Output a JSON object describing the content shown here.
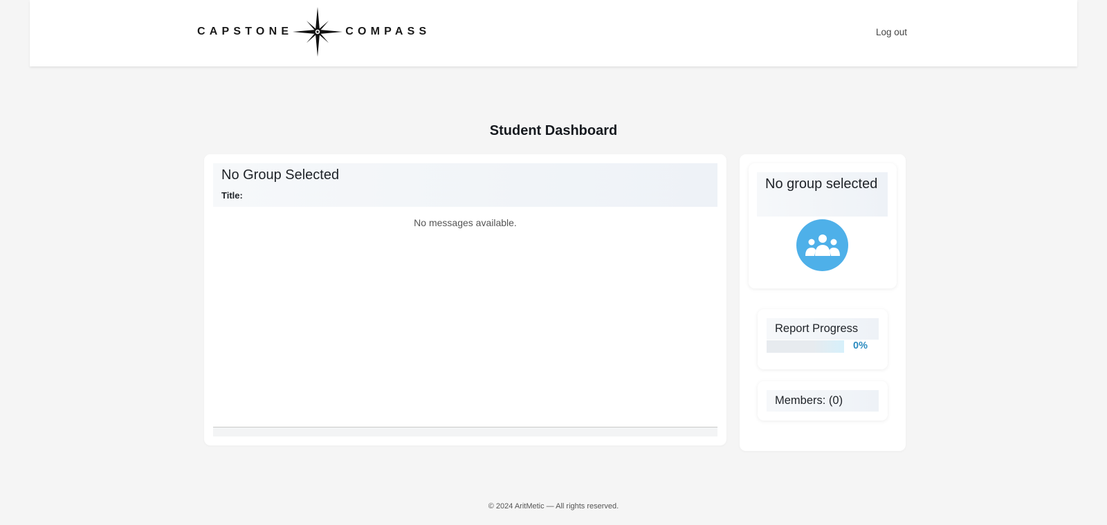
{
  "header": {
    "logo": {
      "word_left": "CAPSTONE",
      "word_right": "COMPASS",
      "icon": "compass-star-icon"
    },
    "logout_label": "Log out"
  },
  "page_title": "Student Dashboard",
  "messages": {
    "group_title": "No Group Selected",
    "title_label": "Title:",
    "empty_text": "No messages available."
  },
  "sidebar": {
    "group": {
      "heading": "No group selected",
      "avatar_icon": "group-icon",
      "avatar_color": "#4eb0e9"
    },
    "progress": {
      "heading": "Report Progress",
      "percent_label": "0%",
      "value": 0,
      "fill_color": "#31a4d8"
    },
    "members": {
      "label": "Members: (0)"
    }
  },
  "footer": {
    "text": "© 2024 AritMetic — All rights reserved."
  }
}
